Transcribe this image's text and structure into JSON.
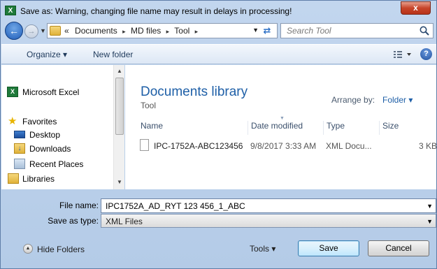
{
  "window": {
    "title": "Save as: Warning, changing file name may result in delays in processing!",
    "close_label": "x",
    "app_icon_label": "X"
  },
  "address": {
    "overflow": "«",
    "crumbs": [
      "Documents",
      "MD files",
      "Tool"
    ],
    "separator": "▸",
    "search_placeholder": "Search Tool"
  },
  "toolbar": {
    "organize_label": "Organize ▾",
    "new_folder_label": "New folder",
    "help_label": "?"
  },
  "sidebar": {
    "items": [
      {
        "label": "Microsoft Excel",
        "icon": "excel-icon"
      },
      {
        "label": "Favorites",
        "icon": "star-icon"
      },
      {
        "label": "Desktop",
        "icon": "desktop-icon"
      },
      {
        "label": "Downloads",
        "icon": "downloads-icon"
      },
      {
        "label": "Recent Places",
        "icon": "recent-places-icon"
      },
      {
        "label": "Libraries",
        "icon": "libraries-icon"
      }
    ]
  },
  "library": {
    "title": "Documents library",
    "subtitle": "Tool",
    "arrange_label": "Arrange by:",
    "arrange_value": "Folder ▾"
  },
  "columns": [
    "Name",
    "Date modified",
    "Type",
    "Size"
  ],
  "files": [
    {
      "name": "IPC-1752A-ABC123456",
      "date": "9/8/2017 3:33 AM",
      "type": "XML Docu...",
      "size": "3 KB"
    }
  ],
  "form": {
    "file_name_label": "File name:",
    "file_name_value": "IPC1752A_AD_RYT 123 456_1_ABC",
    "save_type_label": "Save as type:",
    "save_type_value": "XML Files"
  },
  "footer": {
    "hide_folders_label": "Hide Folders",
    "tools_label": "Tools ▾",
    "save_label": "Save",
    "cancel_label": "Cancel"
  },
  "colors": {
    "accent": "#1e5fa7",
    "close_red": "#c7452a",
    "excel_green": "#1f7a3a"
  }
}
